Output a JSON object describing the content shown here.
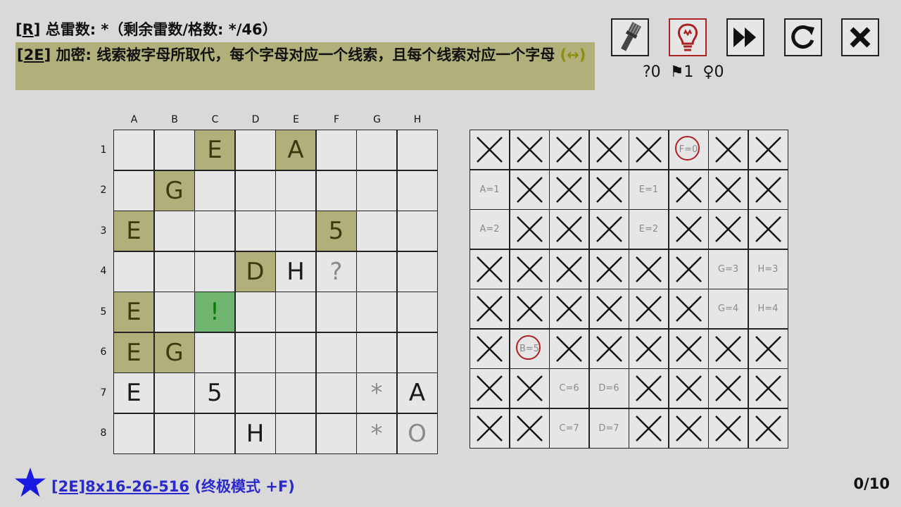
{
  "rule_line": {
    "prefix": "[",
    "letter": "R",
    "suffix": "] 总雷数: *（剩余雷数/格数: */46）"
  },
  "rule_box": {
    "prefix": "[",
    "code": "2E",
    "suffix": "] 加密: 线索被字母所取代，每个字母对应一个线索，且每个线索对应一个字母 ",
    "arrow": "(↔)"
  },
  "toolbar": {
    "buttons": [
      {
        "name": "brush-button",
        "icon": "brush-icon"
      },
      {
        "name": "hint-button",
        "icon": "lightbulb-icon"
      },
      {
        "name": "fast-forward-button",
        "icon": "fast-forward-icon"
      },
      {
        "name": "restart-button",
        "icon": "restart-icon"
      },
      {
        "name": "close-button",
        "icon": "close-icon"
      }
    ],
    "counters": {
      "question": "?0",
      "flag": "⚑1",
      "mine": "♀0"
    }
  },
  "board": {
    "columns": [
      "A",
      "B",
      "C",
      "D",
      "E",
      "F",
      "G",
      "H"
    ],
    "rows": [
      "1",
      "2",
      "3",
      "4",
      "5",
      "6",
      "7",
      "8"
    ],
    "cells": [
      [
        {
          "t": "",
          "s": ""
        },
        {
          "t": "",
          "s": ""
        },
        {
          "t": "E",
          "s": "clue"
        },
        {
          "t": "",
          "s": ""
        },
        {
          "t": "A",
          "s": "clue"
        },
        {
          "t": "",
          "s": ""
        },
        {
          "t": "",
          "s": ""
        },
        {
          "t": "",
          "s": ""
        }
      ],
      [
        {
          "t": "",
          "s": ""
        },
        {
          "t": "G",
          "s": "clue"
        },
        {
          "t": "",
          "s": ""
        },
        {
          "t": "",
          "s": ""
        },
        {
          "t": "",
          "s": ""
        },
        {
          "t": "",
          "s": ""
        },
        {
          "t": "",
          "s": ""
        },
        {
          "t": "",
          "s": ""
        }
      ],
      [
        {
          "t": "E",
          "s": "clue"
        },
        {
          "t": "",
          "s": ""
        },
        {
          "t": "",
          "s": ""
        },
        {
          "t": "",
          "s": ""
        },
        {
          "t": "",
          "s": ""
        },
        {
          "t": "5",
          "s": "clue"
        },
        {
          "t": "",
          "s": ""
        },
        {
          "t": "",
          "s": ""
        }
      ],
      [
        {
          "t": "",
          "s": ""
        },
        {
          "t": "",
          "s": ""
        },
        {
          "t": "",
          "s": ""
        },
        {
          "t": "D",
          "s": "clue"
        },
        {
          "t": "H",
          "s": ""
        },
        {
          "t": "?",
          "s": "grey"
        },
        {
          "t": "",
          "s": ""
        },
        {
          "t": "",
          "s": ""
        }
      ],
      [
        {
          "t": "E",
          "s": "clue"
        },
        {
          "t": "",
          "s": ""
        },
        {
          "t": "!",
          "s": "flag"
        },
        {
          "t": "",
          "s": ""
        },
        {
          "t": "",
          "s": ""
        },
        {
          "t": "",
          "s": ""
        },
        {
          "t": "",
          "s": ""
        },
        {
          "t": "",
          "s": ""
        }
      ],
      [
        {
          "t": "E",
          "s": "clue"
        },
        {
          "t": "G",
          "s": "clue"
        },
        {
          "t": "",
          "s": ""
        },
        {
          "t": "",
          "s": ""
        },
        {
          "t": "",
          "s": ""
        },
        {
          "t": "",
          "s": ""
        },
        {
          "t": "",
          "s": ""
        },
        {
          "t": "",
          "s": ""
        }
      ],
      [
        {
          "t": "E",
          "s": ""
        },
        {
          "t": "",
          "s": ""
        },
        {
          "t": "5",
          "s": ""
        },
        {
          "t": "",
          "s": ""
        },
        {
          "t": "",
          "s": ""
        },
        {
          "t": "",
          "s": ""
        },
        {
          "t": "*",
          "s": "grey"
        },
        {
          "t": "A",
          "s": ""
        }
      ],
      [
        {
          "t": "",
          "s": ""
        },
        {
          "t": "",
          "s": ""
        },
        {
          "t": "",
          "s": ""
        },
        {
          "t": "H",
          "s": ""
        },
        {
          "t": "",
          "s": ""
        },
        {
          "t": "",
          "s": ""
        },
        {
          "t": "*",
          "s": "grey"
        },
        {
          "t": "O",
          "s": "grey"
        }
      ]
    ]
  },
  "matrix": {
    "cells": [
      [
        {
          "k": "x"
        },
        {
          "k": "x"
        },
        {
          "k": "x"
        },
        {
          "k": "x"
        },
        {
          "k": "x"
        },
        {
          "k": "ring",
          "t": "F=0"
        },
        {
          "k": "x"
        },
        {
          "k": "x"
        }
      ],
      [
        {
          "k": "label",
          "t": "A=1"
        },
        {
          "k": "x"
        },
        {
          "k": "x"
        },
        {
          "k": "x"
        },
        {
          "k": "label",
          "t": "E=1"
        },
        {
          "k": "x"
        },
        {
          "k": "x"
        },
        {
          "k": "x"
        }
      ],
      [
        {
          "k": "label",
          "t": "A=2"
        },
        {
          "k": "x"
        },
        {
          "k": "x"
        },
        {
          "k": "x"
        },
        {
          "k": "label",
          "t": "E=2"
        },
        {
          "k": "x"
        },
        {
          "k": "x"
        },
        {
          "k": "x"
        }
      ],
      [
        {
          "k": "x"
        },
        {
          "k": "x"
        },
        {
          "k": "x"
        },
        {
          "k": "x"
        },
        {
          "k": "x"
        },
        {
          "k": "x"
        },
        {
          "k": "label",
          "t": "G=3"
        },
        {
          "k": "label",
          "t": "H=3"
        }
      ],
      [
        {
          "k": "x"
        },
        {
          "k": "x"
        },
        {
          "k": "x"
        },
        {
          "k": "x"
        },
        {
          "k": "x"
        },
        {
          "k": "x"
        },
        {
          "k": "label",
          "t": "G=4"
        },
        {
          "k": "label",
          "t": "H=4"
        }
      ],
      [
        {
          "k": "x"
        },
        {
          "k": "ring",
          "t": "B=5"
        },
        {
          "k": "x"
        },
        {
          "k": "x"
        },
        {
          "k": "x"
        },
        {
          "k": "x"
        },
        {
          "k": "x"
        },
        {
          "k": "x"
        }
      ],
      [
        {
          "k": "x"
        },
        {
          "k": "x"
        },
        {
          "k": "label",
          "t": "C=6"
        },
        {
          "k": "label",
          "t": "D=6"
        },
        {
          "k": "x"
        },
        {
          "k": "x"
        },
        {
          "k": "x"
        },
        {
          "k": "x"
        }
      ],
      [
        {
          "k": "x"
        },
        {
          "k": "x"
        },
        {
          "k": "label",
          "t": "C=7"
        },
        {
          "k": "label",
          "t": "D=7"
        },
        {
          "k": "x"
        },
        {
          "k": "x"
        },
        {
          "k": "x"
        },
        {
          "k": "x"
        }
      ]
    ]
  },
  "footer": {
    "code": "[2E]8x16-26-516",
    "mode": " (终极模式 +F)",
    "progress": "0/10"
  },
  "colors": {
    "clue_bg": "#b2b07a",
    "flag_bg": "#6fb46f",
    "hint_border": "#aa2222",
    "footer_blue": "#2a2acc"
  }
}
